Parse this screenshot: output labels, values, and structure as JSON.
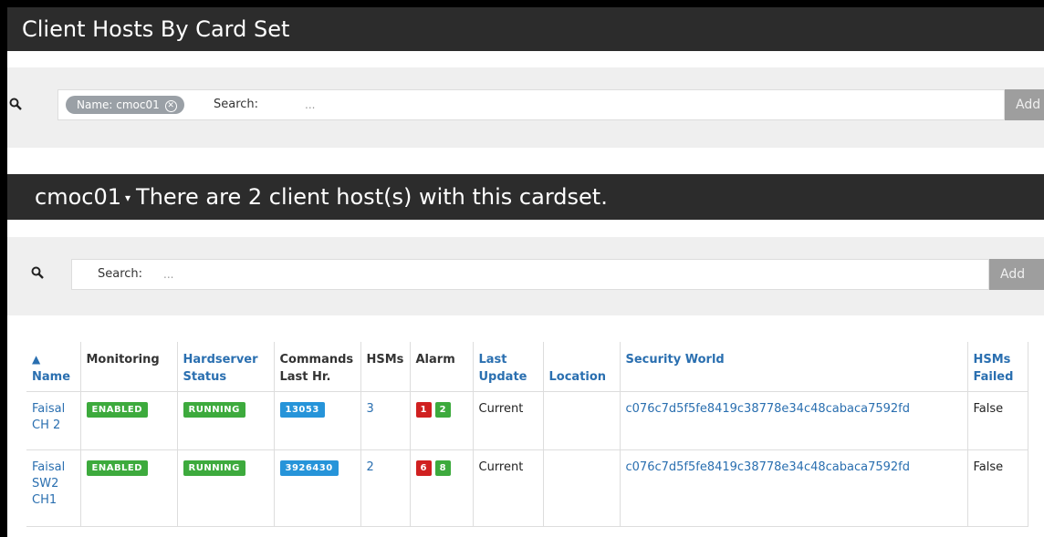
{
  "title": "Client Hosts By Card Set",
  "top_search": {
    "chip_label": "Name: cmoc01",
    "search_label": "Search:",
    "placeholder": "...",
    "add_label": "Add"
  },
  "section": {
    "cardset": "cmoc01",
    "caret": "▾",
    "message": "There are 2 client host(s) with this cardset."
  },
  "host_search": {
    "search_label": "Search:",
    "placeholder": "...",
    "add_label": "Add"
  },
  "table": {
    "headers": {
      "sort_arrow": "▲",
      "name": "Name",
      "monitoring": "Monitoring",
      "hardserver_line1": "Hardserver",
      "hardserver_line2": "Status",
      "commands_line1": "Commands",
      "commands_line2": "Last Hr.",
      "hsms": "HSMs",
      "alarm": "Alarm",
      "last_update_line1": "Last",
      "last_update_line2": "Update",
      "location": "Location",
      "security_world": "Security World",
      "hsms_failed_line1": "HSMs",
      "hsms_failed_line2": "Failed"
    },
    "rows": [
      {
        "name_line1": "Faisal",
        "name_line2": "CH 2",
        "name_line3": "",
        "monitoring": "ENABLED",
        "hardserver": "RUNNING",
        "commands": "13053",
        "hsms": "3",
        "alarm_red": "1",
        "alarm_green": "2",
        "last_update": "Current",
        "location": "",
        "security_world": "c076c7d5f5fe8419c38778e34c48cabaca7592fd",
        "hsms_failed": "False"
      },
      {
        "name_line1": "Faisal",
        "name_line2": "SW2",
        "name_line3": "CH1",
        "monitoring": "ENABLED",
        "hardserver": "RUNNING",
        "commands": "3926430",
        "hsms": "2",
        "alarm_red": "6",
        "alarm_green": "8",
        "last_update": "Current",
        "location": "",
        "security_world": "c076c7d5f5fe8419c38778e34c48cabaca7592fd",
        "hsms_failed": "False"
      }
    ]
  }
}
